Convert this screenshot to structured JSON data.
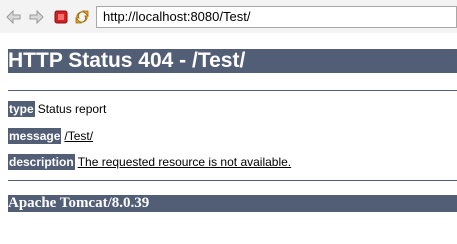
{
  "browser": {
    "address": "http://localhost:8080/Test/",
    "icons": [
      "back-arrow-icon",
      "forward-arrow-icon",
      "stop-icon",
      "reload-icon"
    ]
  },
  "page": {
    "title": "HTTP Status 404 - /Test/",
    "rows": [
      {
        "label": "type",
        "value": "Status report"
      },
      {
        "label": "message",
        "value": "/Test/"
      },
      {
        "label": "description",
        "value": "The requested resource is not available."
      }
    ],
    "footer": "Apache Tomcat/8.0.39"
  },
  "colors": {
    "header_bg": "#525d76",
    "header_text": "#ffffff",
    "stop_red": "#d42020",
    "reload_orange": "#e3a21a",
    "nav_gray": "#b8b8b8"
  }
}
